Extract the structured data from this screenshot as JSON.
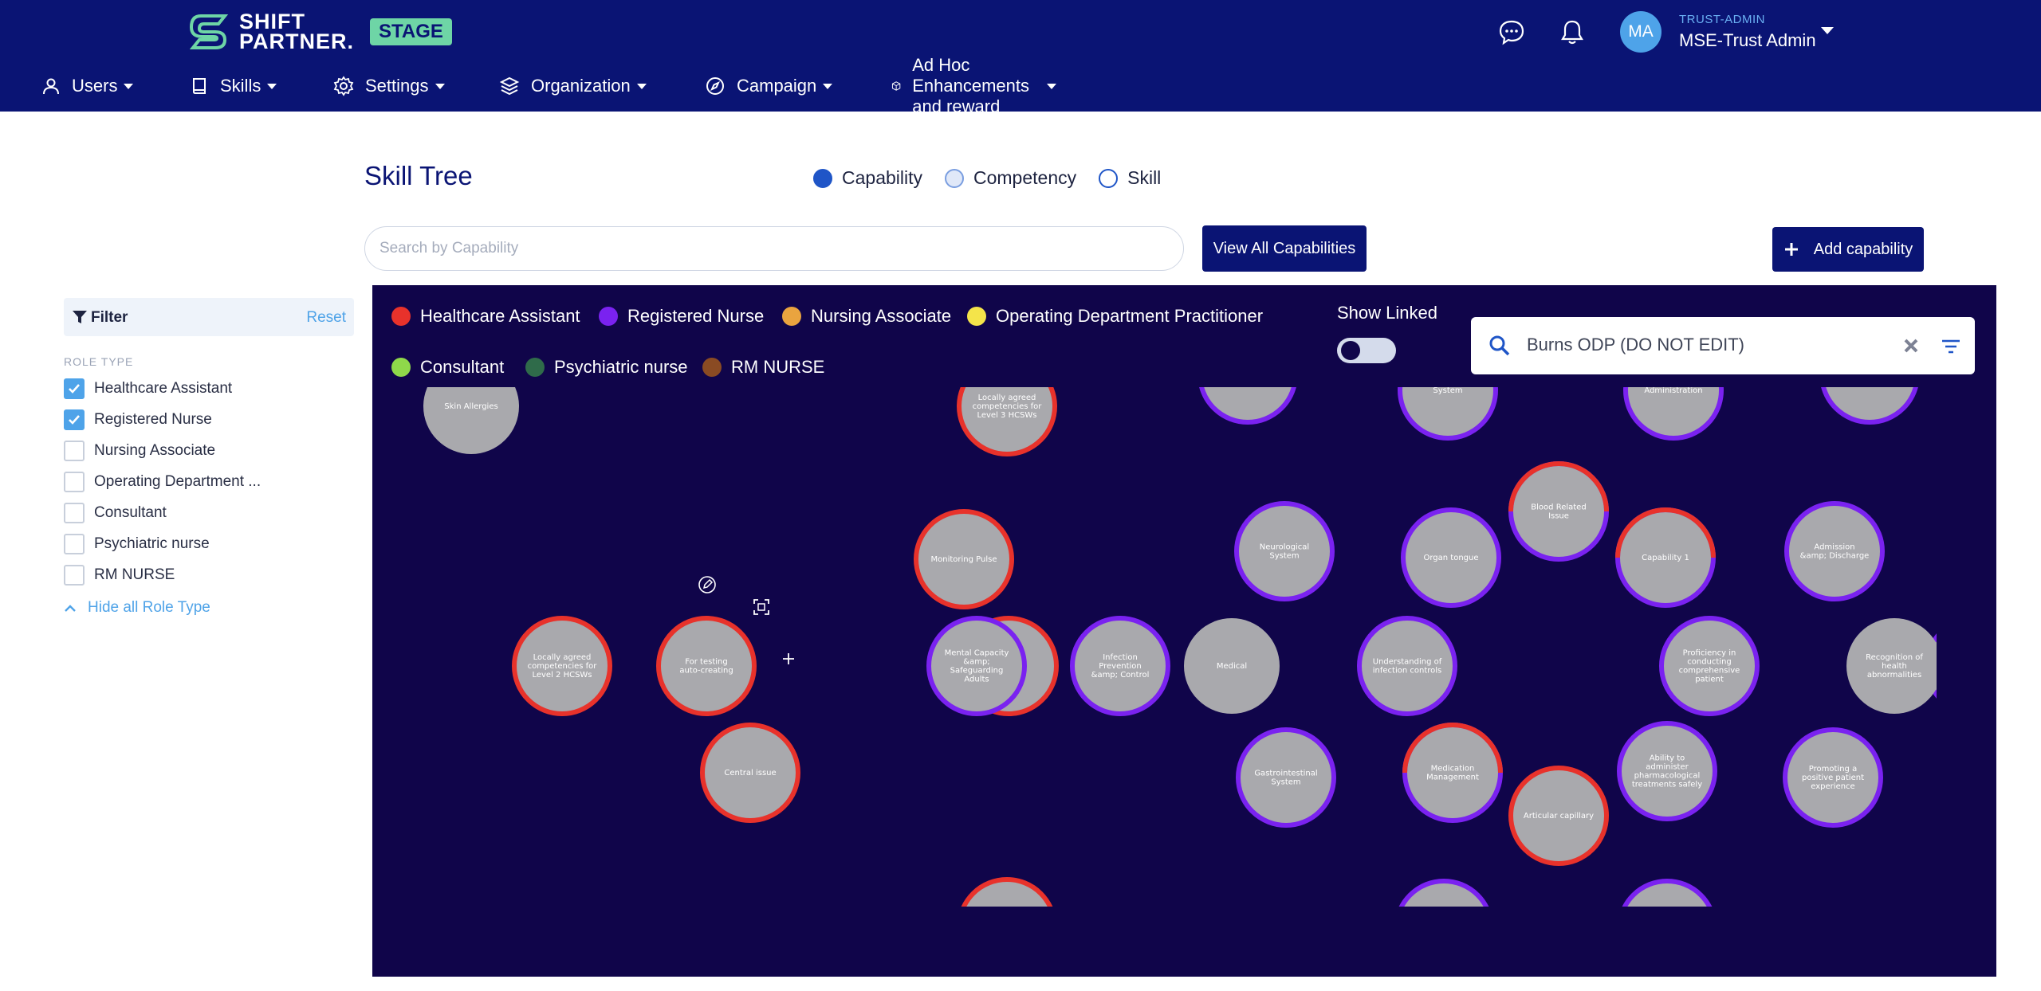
{
  "brand": {
    "name_line1": "SHIFT",
    "name_line2": "PARTNER.",
    "env_badge": "STAGE"
  },
  "user": {
    "initials": "MA",
    "role": "TRUST-ADMIN",
    "name": "MSE-Trust Admin"
  },
  "nav": [
    {
      "label": "Users",
      "icon": "user-icon"
    },
    {
      "label": "Skills",
      "icon": "book-icon"
    },
    {
      "label": "Settings",
      "icon": "gear-icon"
    },
    {
      "label": "Organization",
      "icon": "layers-icon"
    },
    {
      "label": "Campaign",
      "icon": "compass-icon"
    },
    {
      "label": "Ad Hoc Enhancements and reward",
      "icon": "box-icon"
    }
  ],
  "filter": {
    "title": "Filter",
    "reset": "Reset",
    "role_type_heading": "ROLE TYPE",
    "roles": [
      {
        "label": "Healthcare Assistant",
        "checked": true
      },
      {
        "label": "Registered Nurse",
        "checked": true
      },
      {
        "label": "Nursing Associate",
        "checked": false
      },
      {
        "label": "Operating Department ...",
        "checked": false
      },
      {
        "label": "Consultant",
        "checked": false
      },
      {
        "label": "Psychiatric nurse",
        "checked": false
      },
      {
        "label": "RM NURSE",
        "checked": false
      }
    ],
    "hide_all": "Hide all Role Type"
  },
  "page": {
    "title": "Skill Tree",
    "view_options": [
      {
        "label": "Capability",
        "state": "on"
      },
      {
        "label": "Competency",
        "state": "soft"
      },
      {
        "label": "Skill",
        "state": "off"
      }
    ],
    "search_placeholder": "Search by Capability",
    "view_all_label": "View All Capabilities",
    "add_label": "Add capability"
  },
  "graph": {
    "legend": [
      {
        "label": "Healthcare Assistant",
        "color": "#e8322b"
      },
      {
        "label": "Registered Nurse",
        "color": "#7a22f0"
      },
      {
        "label": "Nursing Associate",
        "color": "#eaa43f"
      },
      {
        "label": "Operating Department Practitioner",
        "color": "#f4e44a"
      },
      {
        "label": "Consultant",
        "color": "#8fd84a"
      },
      {
        "label": "Psychiatric nurse",
        "color": "#2f6b4a"
      },
      {
        "label": "RM NURSE",
        "color": "#8a4b23"
      }
    ],
    "show_linked_label": "Show Linked",
    "show_linked_on": false,
    "search_value": "Burns ODP (DO NOT EDIT)",
    "nodes": [
      {
        "label": "Skin Allergies",
        "ring": "none"
      },
      {
        "label": "Locally agreed|competencies for|Level 3 HCSWs",
        "ring": "red"
      },
      {
        "label": "System",
        "ring": "purple"
      },
      {
        "label": "Administration",
        "ring": "purple"
      },
      {
        "label": "Monitoring Pulse",
        "ring": "red"
      },
      {
        "label": "Neurological|System",
        "ring": "purple"
      },
      {
        "label": "Organ tongue",
        "ring": "purple"
      },
      {
        "label": "Blood Related|Issue",
        "ring": "mixed"
      },
      {
        "label": "Capability 1",
        "ring": "mixed"
      },
      {
        "label": "Admission|&amp; Discharge",
        "ring": "purple"
      },
      {
        "label": "Locally agreed|competencies for|Level 2 HCSWs",
        "ring": "red"
      },
      {
        "label": "For testing|auto-creating",
        "ring": "red"
      },
      {
        "label": "Mental Capacity|&amp;|Safeguarding|Adults",
        "ring": "purple"
      },
      {
        "label": "Infection|Prevention|&amp; Control",
        "ring": "purple"
      },
      {
        "label": "Medical",
        "ring": "none"
      },
      {
        "label": "Understanding of|infection controls",
        "ring": "purple"
      },
      {
        "label": "Proficiency in|conducting|comprehensive|patient",
        "ring": "purple"
      },
      {
        "label": "Recognition of|health|abnormalities",
        "ring": "none"
      },
      {
        "label": "Central issue",
        "ring": "red"
      },
      {
        "label": "Gastrointestinal|System",
        "ring": "purple"
      },
      {
        "label": "Medication|Management",
        "ring": "mixed"
      },
      {
        "label": "Articular capillary",
        "ring": "red"
      },
      {
        "label": "Ability to|administer|pharmacological|treatments safely",
        "ring": "purple"
      },
      {
        "label": "Promoting a|positive patient|experience",
        "ring": "purple"
      }
    ]
  }
}
